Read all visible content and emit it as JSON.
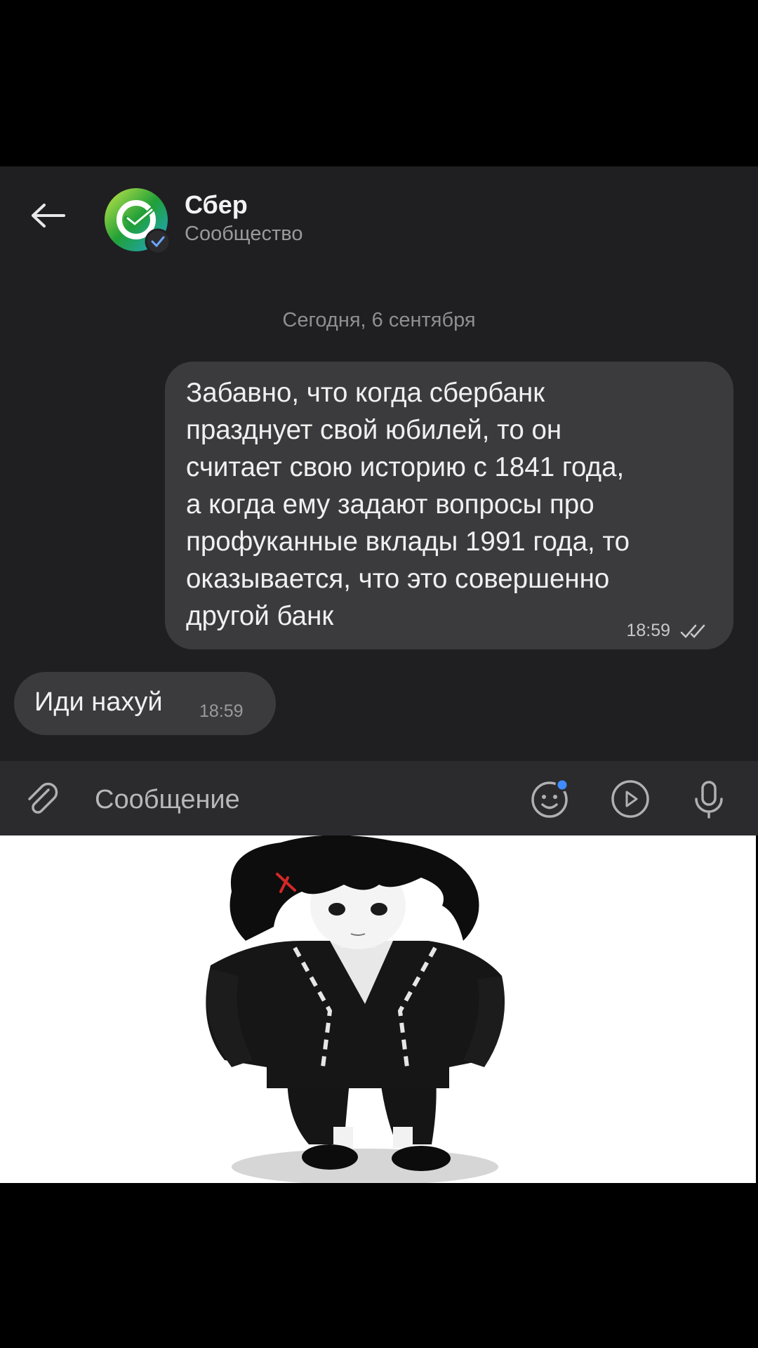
{
  "header": {
    "title": "Сбер",
    "subtitle": "Сообщество",
    "avatar_icon": "sber-logo-icon",
    "verified_icon": "verified-check-icon",
    "brand_color": "#21a038"
  },
  "chat": {
    "date_separator": "Сегодня, 6 сентября",
    "messages": [
      {
        "direction": "outgoing",
        "text": "Забавно, что когда сбербанк\nпразднует свой юбилей, то он\nсчитает свою историю с 1841 года,\nа когда ему задают вопросы про\nпрофуканные вклады 1991 года, то\nоказывается, что это совершенно\nдругой банк",
        "time": "18:59",
        "status_icon": "double-check-icon"
      },
      {
        "direction": "incoming",
        "text": "Иди нахуй",
        "time": "18:59"
      }
    ]
  },
  "composer": {
    "placeholder": "Сообщение",
    "attach_icon": "paperclip-icon",
    "emoji_icon": "emoji-icon",
    "video_icon": "play-circle-icon",
    "voice_icon": "microphone-icon"
  },
  "sticker": {
    "description_icon": "anime-character-sticker"
  }
}
